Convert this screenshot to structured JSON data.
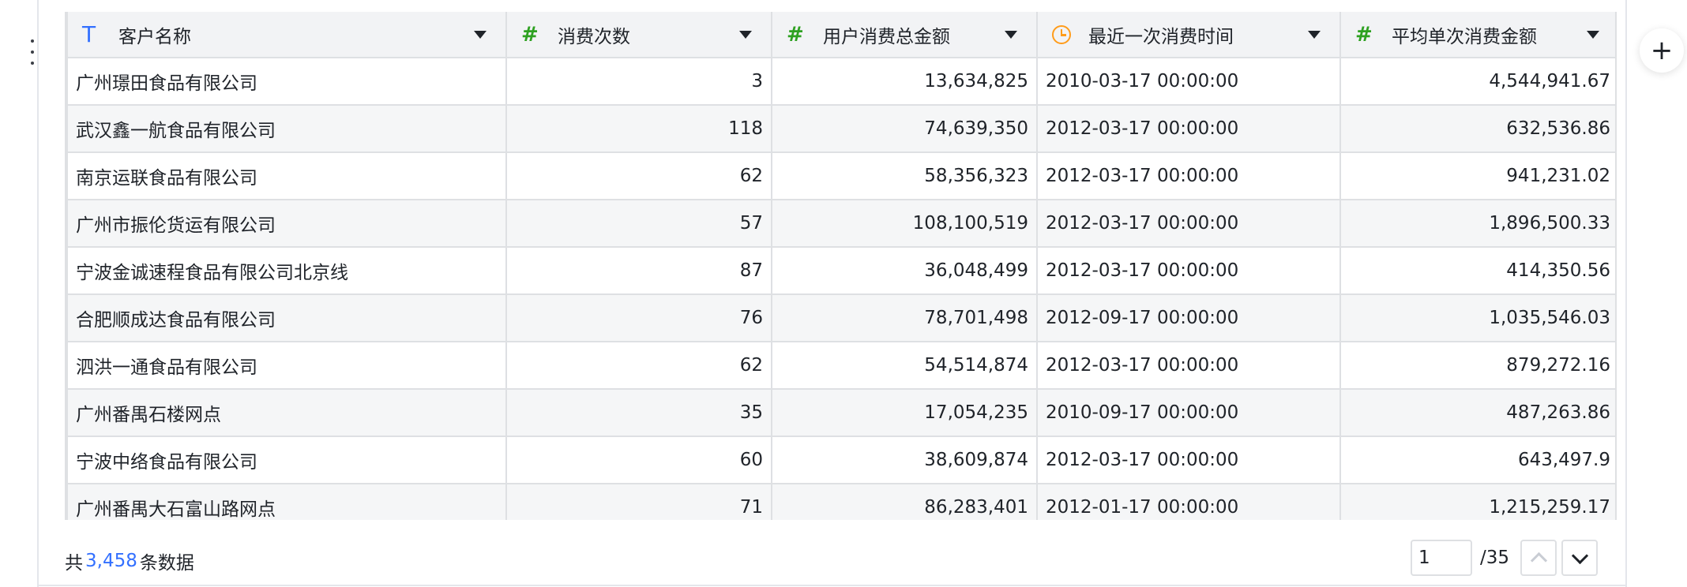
{
  "table": {
    "columns": [
      {
        "label": "客户名称",
        "type": "text",
        "icon": "text-type-icon"
      },
      {
        "label": "消费次数",
        "type": "number",
        "icon": "number-type-icon"
      },
      {
        "label": "用户消费总金额",
        "type": "number",
        "icon": "number-type-icon"
      },
      {
        "label": "最近一次消费时间",
        "type": "datetime",
        "icon": "clock-icon"
      },
      {
        "label": "平均单次消费金额",
        "type": "number",
        "icon": "number-type-icon"
      }
    ],
    "rows": [
      [
        "广州璟田食品有限公司",
        "3",
        "13,634,825",
        "2010-03-17 00:00:00",
        "4,544,941.67"
      ],
      [
        "武汉鑫一航食品有限公司",
        "118",
        "74,639,350",
        "2012-03-17 00:00:00",
        "632,536.86"
      ],
      [
        "南京运联食品有限公司",
        "62",
        "58,356,323",
        "2012-03-17 00:00:00",
        "941,231.02"
      ],
      [
        "广州市振伦货运有限公司",
        "57",
        "108,100,519",
        "2012-03-17 00:00:00",
        "1,896,500.33"
      ],
      [
        "宁波金诚速程食品有限公司北京线",
        "87",
        "36,048,499",
        "2012-03-17 00:00:00",
        "414,350.56"
      ],
      [
        "合肥顺成达食品有限公司",
        "76",
        "78,701,498",
        "2012-09-17 00:00:00",
        "1,035,546.03"
      ],
      [
        "泗洪一通食品有限公司",
        "62",
        "54,514,874",
        "2012-03-17 00:00:00",
        "879,272.16"
      ],
      [
        "广州番禺石楼网点",
        "35",
        "17,054,235",
        "2010-09-17 00:00:00",
        "487,263.86"
      ],
      [
        "宁波中络食品有限公司",
        "60",
        "38,609,874",
        "2012-03-17 00:00:00",
        "643,497.9"
      ],
      [
        "广州番禺大石富山路网点",
        "71",
        "86,283,401",
        "2012-01-17 00:00:00",
        "1,215,259.17"
      ]
    ]
  },
  "footer": {
    "total_prefix": "共",
    "total_count": "3,458",
    "total_suffix": "条数据",
    "page_value": "1",
    "page_total": "/35"
  },
  "colors": {
    "accent": "#3370ff",
    "number_icon": "#2ea121",
    "clock_icon": "#ff9c1a"
  }
}
